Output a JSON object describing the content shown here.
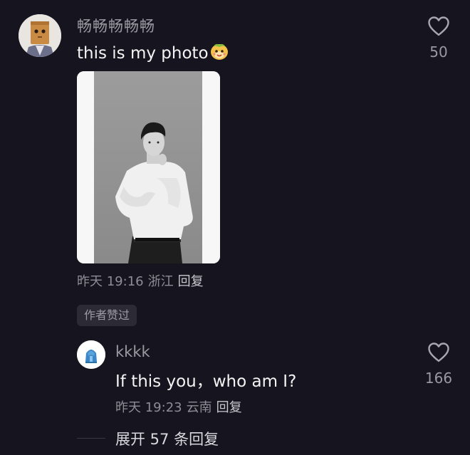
{
  "comment": {
    "username": "畅畅畅畅畅",
    "text": "this is my photo",
    "like_count": "50",
    "time": "昨天 19:16",
    "location": "浙江",
    "reply_label": "回复",
    "author_liked_badge": "作者赞过"
  },
  "reply": {
    "username": "kkkk",
    "text": "If this you，who am I?",
    "like_count": "166",
    "time": "昨天 19:23",
    "location": "云南",
    "reply_label": "回复"
  },
  "expand": {
    "label": "展开 57 条回复"
  },
  "icons": {
    "like": "heart-outline-icon",
    "emoji": "smiling-face-emoji-icon"
  },
  "colors": {
    "background": "#16151f",
    "primary_text": "#f4f4f4",
    "secondary_text": "#9a99a2",
    "badge_bg": "#2b2a35"
  }
}
